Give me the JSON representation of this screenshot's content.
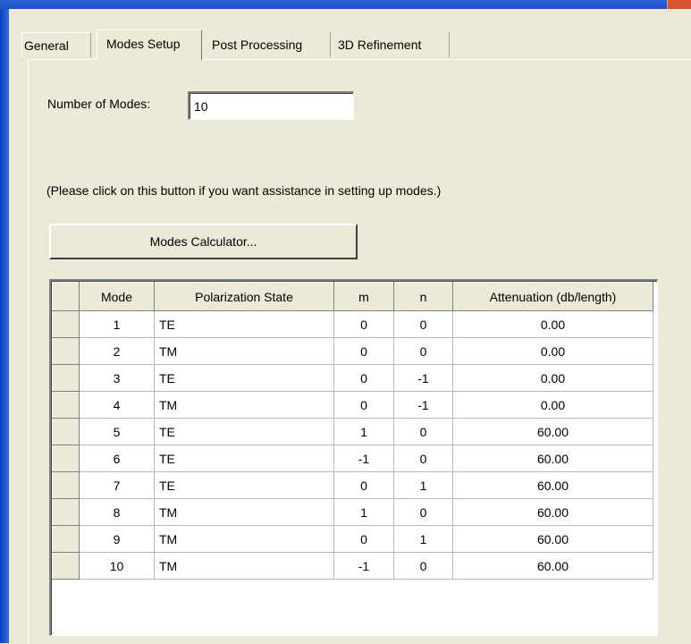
{
  "tabs": [
    {
      "label": "General"
    },
    {
      "label": "Modes Setup"
    },
    {
      "label": "Post Processing"
    },
    {
      "label": "3D Refinement"
    }
  ],
  "active_tab": "Modes Setup",
  "form": {
    "num_modes_label": "Number of Modes:",
    "num_modes_value": "10",
    "help_text": "(Please click on this button if you want assistance in setting up modes.)",
    "calculator_button": "Modes Calculator..."
  },
  "table": {
    "columns": [
      "Mode",
      "Polarization State",
      "m",
      "n",
      "Attenuation (db/length)"
    ],
    "rows": [
      {
        "mode": "1",
        "pol": "TE",
        "m": "0",
        "n": "0",
        "att": "0.00"
      },
      {
        "mode": "2",
        "pol": "TM",
        "m": "0",
        "n": "0",
        "att": "0.00"
      },
      {
        "mode": "3",
        "pol": "TE",
        "m": "0",
        "n": "-1",
        "att": "0.00"
      },
      {
        "mode": "4",
        "pol": "TM",
        "m": "0",
        "n": "-1",
        "att": "0.00"
      },
      {
        "mode": "5",
        "pol": "TE",
        "m": "1",
        "n": "0",
        "att": "60.00"
      },
      {
        "mode": "6",
        "pol": "TE",
        "m": "-1",
        "n": "0",
        "att": "60.00"
      },
      {
        "mode": "7",
        "pol": "TE",
        "m": "0",
        "n": "1",
        "att": "60.00"
      },
      {
        "mode": "8",
        "pol": "TM",
        "m": "1",
        "n": "0",
        "att": "60.00"
      },
      {
        "mode": "9",
        "pol": "TM",
        "m": "0",
        "n": "1",
        "att": "60.00"
      },
      {
        "mode": "10",
        "pol": "TM",
        "m": "-1",
        "n": "0",
        "att": "60.00"
      }
    ]
  },
  "colors": {
    "dialog_bg": "#ece9d8",
    "titlebar_blue": "#1b4fc4",
    "close_button": "#d8542f"
  }
}
